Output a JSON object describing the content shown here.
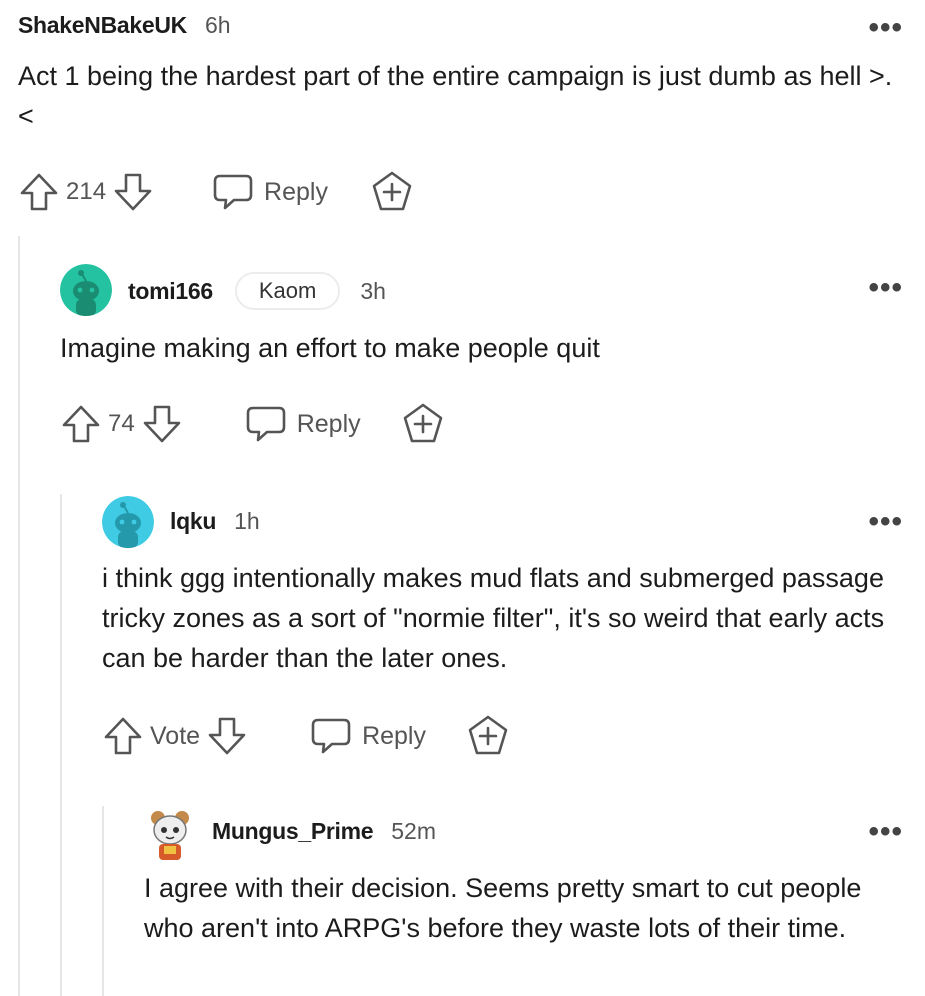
{
  "comments": [
    {
      "author": "ShakeNBakeUK",
      "time": "6h",
      "body": "Act 1 being the hardest part of the entire campaign is just dumb as hell >.<",
      "votes": "214",
      "reply_label": "Reply"
    },
    {
      "author": "tomi166",
      "flair": "Kaom",
      "time": "3h",
      "body": "Imagine making an effort to make people quit",
      "votes": "74",
      "reply_label": "Reply",
      "avatar_color": "#24c2a0"
    },
    {
      "author": "lqku",
      "time": "1h",
      "body": "i think ggg intentionally makes mud flats and submerged passage tricky zones as a sort of \"normie filter\", it's so weird that early acts can be harder than the later ones.",
      "votes": "Vote",
      "reply_label": "Reply",
      "avatar_color": "#3ecbe3"
    },
    {
      "author": "Mungus_Prime",
      "time": "52m",
      "body": "I agree with their decision. Seems pretty smart to cut people who aren't into ARPG's before they waste lots of their time."
    }
  ],
  "more_label": "•••",
  "icons": {
    "upvote": "upvote-arrow-icon",
    "downvote": "downvote-arrow-icon",
    "reply": "speech-bubble-icon",
    "award": "award-plus-icon",
    "more": "more-options-icon"
  },
  "colors": {
    "text": "#1c1c1c",
    "muted": "#555555",
    "thread_line": "#e6e6e6"
  }
}
